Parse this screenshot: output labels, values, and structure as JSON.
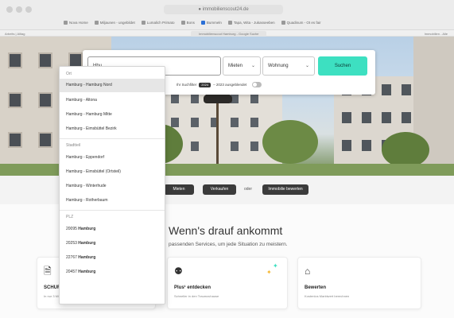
{
  "browser": {
    "url": "● immobilienscout24.de",
    "bookmarks": [
      "Nova Home",
      "Miljaunen - ungebildet",
      "Lumalich Primato",
      "Bons",
      "Bummeln",
      "Tapa, Wita - Jukasseeben",
      "Quadinum - Ot es fair"
    ],
    "tab_left": "Arbeits | Alltag",
    "tab_center": "Immobilienscout Hamburg - Google Suche",
    "tab_right": "Immobilien - Alle"
  },
  "search": {
    "location_value": "Hbu",
    "rent_label": "Mieten",
    "type_label": "Wohnung",
    "submit_label": "Suchen",
    "filter_prefix": "Ihr Suchfilter",
    "filter_badge": "2024",
    "filter_suffix": "– 2023 ausgeblendet"
  },
  "dropdown": {
    "section_orte": "Ort",
    "orte": [
      "Hamburg - Hamburg Nord",
      "Hamburg - Altona",
      "Hamburg - Hamburg Mitte",
      "Hamburg - Eimsbüttel Bezirk"
    ],
    "section_stadtteil": "Stadtteil",
    "stadtteile": [
      "Hamburg - Eppendorf",
      "Hamburg - Eimsbüttel (Ortsteil)",
      "Hamburg - Winterhude",
      "Hamburg - Rotherbaum"
    ],
    "section_plz": "PLZ",
    "plz": [
      {
        "code": "20095",
        "city": "Hamburg"
      },
      {
        "code": "20253",
        "city": "Hamburg"
      },
      {
        "code": "22767",
        "city": "Hamburg"
      },
      {
        "code": "20457",
        "city": "Hamburg"
      }
    ]
  },
  "actions": {
    "mieten": "Mieten",
    "verkaufen": "Verkaufen",
    "oder": "oder",
    "bewerten": "Immobilie bewerten"
  },
  "content": {
    "headline": "Wenn's drauf ankommt",
    "subline": "passenden Services, um jede Situation zu meistern."
  },
  "cards": [
    {
      "title": "SCHUFA-BonitätsCheck",
      "text": "In nur 3 Minuten online erhalten",
      "icon": "document-check-icon"
    },
    {
      "title": "Plus¹ entdecken",
      "text": "Schneller in den Traumzuhause",
      "icon": "user-plus-icon"
    },
    {
      "title": "Bewerten",
      "text": "Kostenlos Marktwert berechnen",
      "icon": "house-value-icon"
    }
  ],
  "colors": {
    "accent": "#3de0c1",
    "dark_button": "#3b3b3b",
    "dropdown_highlight": "#e6e6e6"
  }
}
